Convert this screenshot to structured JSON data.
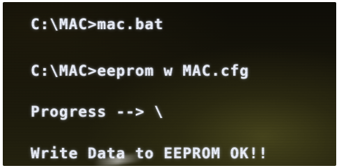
{
  "terminal": {
    "lines": [
      "C:\\MAC>mac.bat",
      "C:\\MAC>eeprom w MAC.cfg",
      "Progress --> \\",
      "Write Data to EEPROM OK!!"
    ]
  },
  "colors": {
    "text": "#e8ecf6",
    "background": "#16140a"
  }
}
